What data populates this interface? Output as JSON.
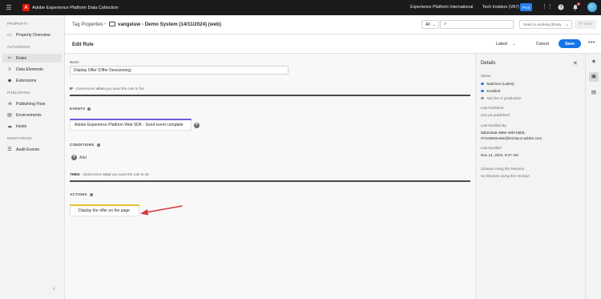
{
  "topbar": {
    "app_title": "Adobe Experience Platform Data Collection",
    "org": "Experience Platform International",
    "sandbox": "Tech Insiders (VA7)",
    "env_badge": "Prod",
    "notification_count": "1"
  },
  "leftnav": {
    "sections": [
      {
        "title": "PROPERTY",
        "items": [
          {
            "label": "Property Overview",
            "icon": "monitor-icon"
          }
        ]
      },
      {
        "title": "AUTHORING",
        "items": [
          {
            "label": "Rules",
            "icon": "rules-icon",
            "active": true
          },
          {
            "label": "Data Elements",
            "icon": "database-icon"
          },
          {
            "label": "Extensions",
            "icon": "extensions-icon"
          }
        ]
      },
      {
        "title": "PUBLISHING",
        "items": [
          {
            "label": "Publishing Flow",
            "icon": "flow-icon"
          },
          {
            "label": "Environments",
            "icon": "environments-icon"
          },
          {
            "label": "Hosts",
            "icon": "cloud-icon"
          }
        ]
      },
      {
        "title": "MONITORING",
        "items": [
          {
            "label": "Audit Events",
            "icon": "list-icon"
          }
        ]
      }
    ]
  },
  "header": {
    "breadcrumb": "Tag Properties",
    "property_name": "vangeluw - Demo System (14/11/2024) (web)",
    "filter_value": "All",
    "library_placeholder": "Select a working library",
    "build_label": "Build"
  },
  "editbar": {
    "title": "Edit Rule",
    "version": "Latest",
    "cancel_label": "Cancel",
    "save_label": "Save"
  },
  "rule": {
    "name_label": "Name",
    "name_value": "Display Offer (Offer Decisioning)",
    "if_prefix": "IF",
    "if_text": "- Determines",
    "if_text_plain": "when",
    "if_text_suffix": "you want the rule to fire",
    "events_head": "EVENTS",
    "event_card": "Adobe Experience Platform Web SDK - Send event complete",
    "conditions_head": "CONDITIONS",
    "add_label": "Add",
    "then_prefix": "THEN",
    "then_text": "- Determines",
    "then_text_plain": "what",
    "then_text_suffix": "you want the rule to do",
    "actions_head": "ACTIONS",
    "action_card": "Display the offer on the page"
  },
  "details": {
    "title": "Details",
    "status_label": "Status",
    "statuses": [
      {
        "text": "Matches (Latest)",
        "color": "#2680eb"
      },
      {
        "text": "Enabled",
        "color": "#2680eb"
      },
      {
        "text": "Not live in production",
        "color": "#959595"
      }
    ],
    "last_published_label": "Last Published",
    "last_published_value": "Not yet published",
    "last_modified_by_label": "Last Modified By",
    "last_modified_by_value_1": "66b219a5-388e-49f4-b5bb-",
    "last_modified_by_value_2": "074c8892ea9e@techacct.adobe.com",
    "last_modified_label": "Last Modified",
    "last_modified_value": "Nov 14, 2024, 9:27 AM",
    "libraries_label": "Libraries Using this Revision",
    "libraries_value": "No libraries using this revision"
  },
  "colors": {
    "accent_blue": "#1473e6",
    "event_accent": "#6e59d9",
    "action_accent": "#e6c02a",
    "arrow": "#d7373f"
  }
}
